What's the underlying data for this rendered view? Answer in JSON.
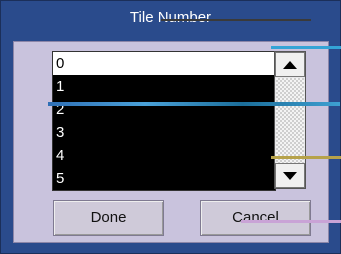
{
  "dialog": {
    "title": "Tile Number"
  },
  "list": {
    "items": [
      "0",
      "1",
      "2",
      "3",
      "4",
      "5"
    ],
    "selected_index": 0
  },
  "scrollbar": {
    "up_icon": "triangle-up",
    "down_icon": "triangle-down"
  },
  "buttons": {
    "done_label": "Done",
    "cancel_label": "Cancel"
  },
  "colors": {
    "dialog_bg": "#2a4b8c",
    "panel_bg": "#c9c3dd",
    "list_bg": "#000000",
    "selected_bg": "#ffffff"
  }
}
